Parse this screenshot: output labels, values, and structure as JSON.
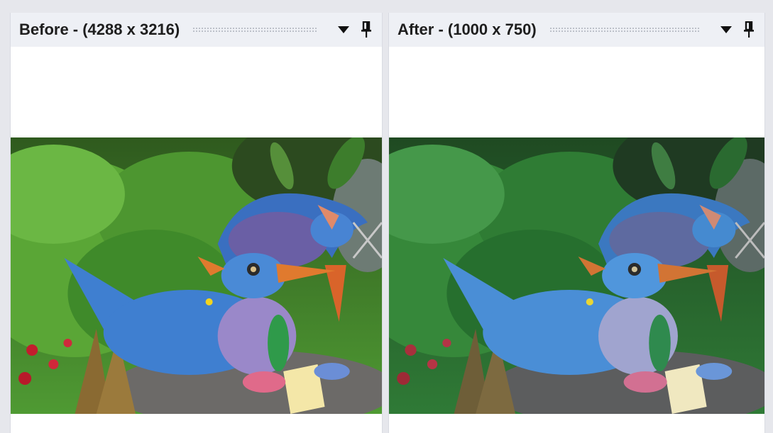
{
  "panels": {
    "before": {
      "title": "Before - (4288 x 3216)",
      "dropdown_icon": "triangle-down-icon",
      "pin_icon": "pushpin-icon"
    },
    "after": {
      "title": "After - (1000 x 750)",
      "dropdown_icon": "triangle-down-icon",
      "pin_icon": "pushpin-icon"
    }
  },
  "colors": {
    "header_bg": "#eef0f5",
    "window_bg": "#e6e7ec",
    "title_text": "#1e1e1e",
    "bird_blue": "#3f7fd0",
    "bird_purple": "#9a88c9",
    "beak_orange": "#e07a2e",
    "hedge_green": "#3f8a2a"
  }
}
